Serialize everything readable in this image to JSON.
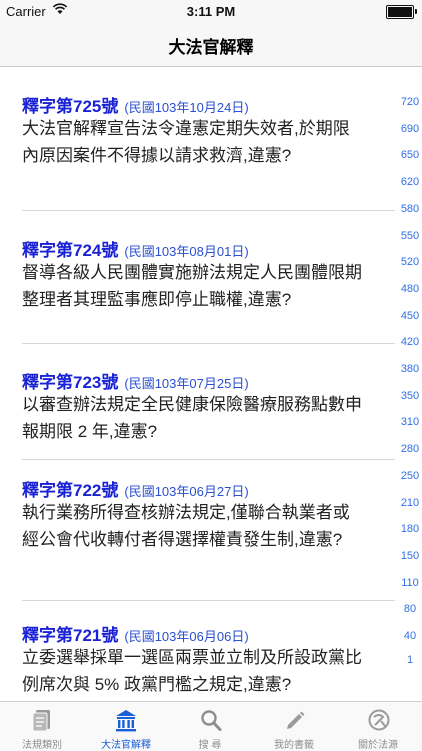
{
  "status": {
    "carrier": "Carrier",
    "time": "3:11 PM"
  },
  "nav": {
    "title": "大法官解釋"
  },
  "items": [
    {
      "number": "釋字第725號",
      "date": "(民國103年10月24日)",
      "lines": [
        "大法官解釋宣告法令違憲定期失效者,於期限",
        "內原因案件不得據以請求救濟,違憲?"
      ]
    },
    {
      "number": "釋字第724號",
      "date": "(民國103年08月01日)",
      "lines": [
        "督導各級人民團體實施辦法規定人民團體限期",
        "整理者其理監事應即停止職權,違憲?"
      ]
    },
    {
      "number": "釋字第723號",
      "date": "(民國103年07月25日)",
      "lines": [
        "以審查辦法規定全民健康保險醫療服務點數申",
        "報期限 2 年,違憲?"
      ]
    },
    {
      "number": "釋字第722號",
      "date": "(民國103年06月27日)",
      "lines": [
        "執行業務所得查核辦法規定,僅聯合執業者或",
        "經公會代收轉付者得選擇權責發生制,違憲?"
      ]
    },
    {
      "number": "釋字第721號",
      "date": "(民國103年06月06日)",
      "lines": [
        "立委選舉採單一選區兩票並立制及所設政黨比",
        "例席次與 5% 政黨門檻之規定,違憲?"
      ]
    }
  ],
  "index": [
    "720",
    "690",
    "650",
    "620",
    "580",
    "550",
    "520",
    "480",
    "450",
    "420",
    "380",
    "350",
    "310",
    "280",
    "250",
    "210",
    "180",
    "150",
    "110",
    "80",
    "40",
    "1"
  ],
  "tabs": [
    {
      "label": "法規類別",
      "icon": "document-icon"
    },
    {
      "label": "大法官解釋",
      "icon": "courthouse-icon",
      "active": true
    },
    {
      "label": "搜  尋",
      "icon": "search-icon"
    },
    {
      "label": "我的書籤",
      "icon": "pencil-icon"
    },
    {
      "label": "關於法源",
      "icon": "logo-icon"
    }
  ],
  "colors": {
    "accent": "#1a5fd6",
    "number": "#1a22d6",
    "index": "#2f6fe6"
  }
}
